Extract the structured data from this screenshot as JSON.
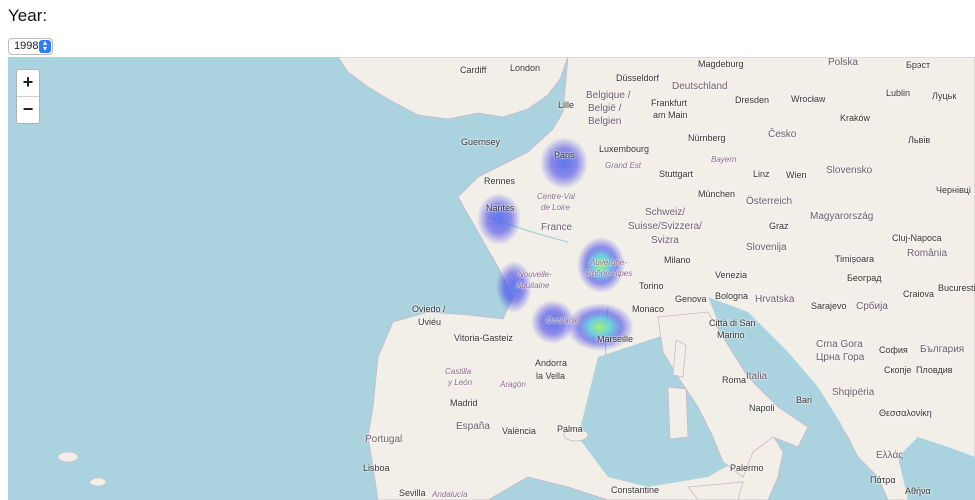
{
  "controls": {
    "year_label": "Year:",
    "year_value": "1998"
  },
  "zoom": {
    "in_label": "+",
    "out_label": "−"
  },
  "colors": {
    "water": "#aad3df",
    "land": "#f2efe9",
    "heat_low": "#3a3ae6",
    "heat_high": "#9ef06a"
  },
  "labels": {
    "cardiff": "Cardiff",
    "london": "London",
    "lille": "Lille",
    "belgique": "Belgique /",
    "belgie": "België /",
    "belgien": "Belgien",
    "dusseldorf": "Düsseldorf",
    "deutschland": "Deutschland",
    "frankfurt": "Frankfurt",
    "am_main": "am Main",
    "magdeburg": "Magdeburg",
    "polska": "Polska",
    "brest_pl": "Брэст",
    "dresden": "Dresden",
    "wroclaw": "Wrocław",
    "lublin": "Lublin",
    "lutsk": "Луцьк",
    "krakow": "Kraków",
    "lviv": "Львів",
    "cesko": "Česko",
    "nurnberg": "Nürnberg",
    "bayern": "Bayern",
    "luxembourg": "Luxembourg",
    "grand_est": "Grand Est",
    "stuttgart": "Stuttgart",
    "munchen": "München",
    "linz": "Linz",
    "wien": "Wien",
    "osterreich": "Österreich",
    "slovensko": "Slovensko",
    "chernivtsi": "Чернівці",
    "guernsey": "Guernsey",
    "paris": "Paris",
    "rennes": "Rennes",
    "centre1": "Centre-Val",
    "centre2": "de Loire",
    "nantes": "Nantes",
    "france": "France",
    "schweiz": "Schweiz/",
    "suisse": "Suisse/Svizzera/",
    "svizra": "Svizra",
    "graz": "Graz",
    "magyarorszag": "Magyarország",
    "cluj": "Cluj-Napoca",
    "romania": "România",
    "slovenija": "Slovenija",
    "milano": "Milano",
    "venezia": "Venezia",
    "timisoara": "Timișoara",
    "beograd": "Београд",
    "nouvelle1": "Nouvelle-",
    "nouvelle2": "Aquitaine",
    "auvergne": "Auvergne-",
    "rhone": "Rhône-Alpes",
    "torino": "Torino",
    "genova": "Genova",
    "bologna": "Bologna",
    "hrvatska": "Hrvatska",
    "sarajevo": "Sarajevo",
    "srbija": "Србија",
    "craiova": "Craiova",
    "bucuresti": "Bucuresti",
    "oviedo": "Oviedo /",
    "uvieu": "Uviéu",
    "occitanie": "Occitanie",
    "monaco": "Monaco",
    "citta_san": "Città di San",
    "marino": "Marino",
    "vitoria": "Vitoria-Gasteiz",
    "marseille": "Marseille",
    "crna_gora": "Crna Gora",
    "crna_gora_cyr": "Црна Гора",
    "sofia": "София",
    "bulgaria": "България",
    "andorra": "Andorra",
    "la_vella": "la Vella",
    "castilla": "Castilla",
    "y_leon": "y León",
    "aragon": "Aragón",
    "roma": "Roma",
    "italia": "Italia",
    "skopje": "Скопје",
    "plovdiv": "Пловдив",
    "madrid": "Madrid",
    "bari": "Bari",
    "shqiperia": "Shqipëria",
    "espana": "España",
    "valencia": "València",
    "palma": "Palma",
    "napoli": "Napoli",
    "thessaloniki": "Θεσσαλονίκη",
    "portugal": "Portugal",
    "lisboa": "Lisboa",
    "palermo": "Palermo",
    "ellas": "Ελλάς",
    "sevilla": "Sevilla",
    "andalucia": "Andalucía",
    "constantine": "Constantine",
    "patra": "Πάτρα",
    "athina": "Αθήνα"
  }
}
